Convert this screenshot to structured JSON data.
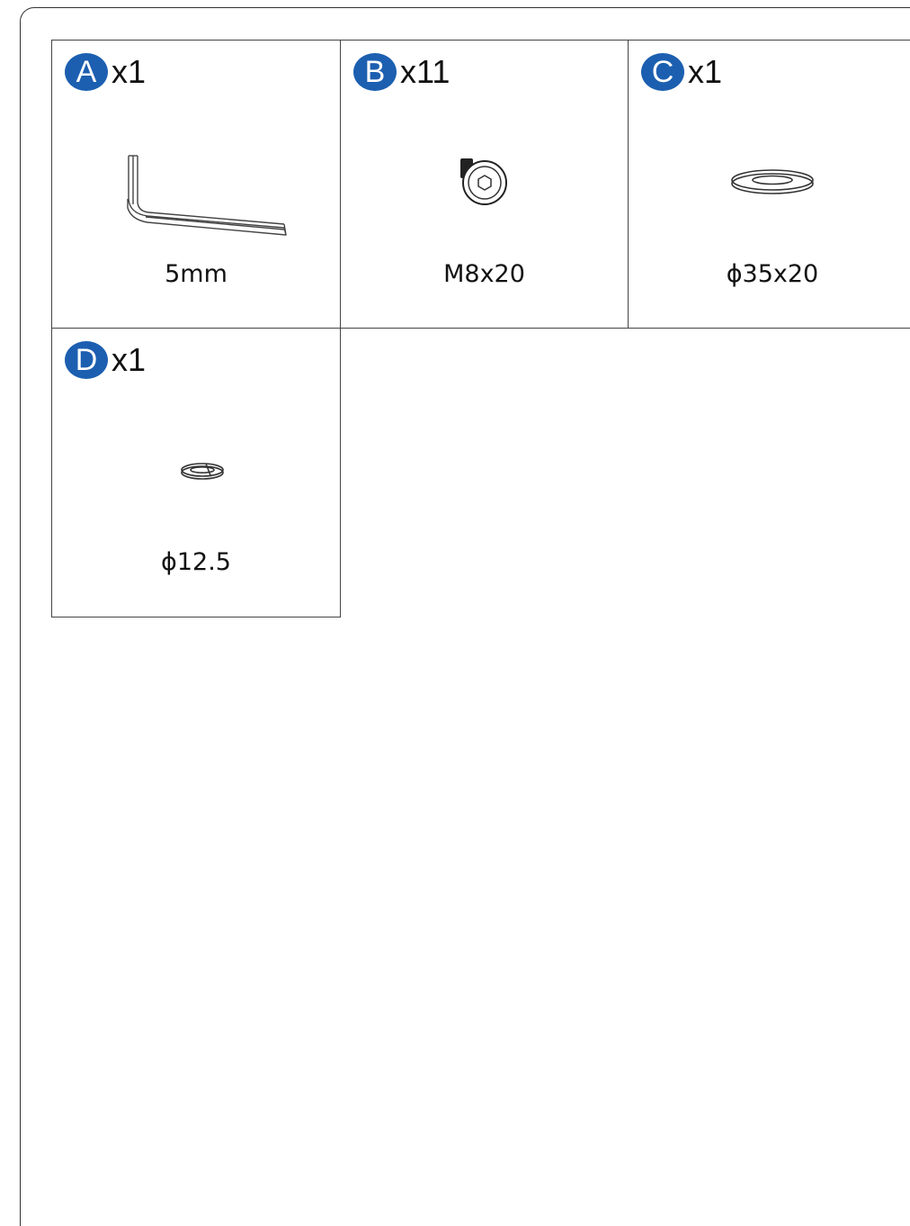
{
  "parts": [
    {
      "letter": "A",
      "qty": "x1",
      "spec": "5mm",
      "icon": "hex-key-icon"
    },
    {
      "letter": "B",
      "qty": "x11",
      "spec": "M8x20",
      "icon": "hex-bolt-icon"
    },
    {
      "letter": "C",
      "qty": "x1",
      "spec": "ϕ35x20",
      "icon": "flat-washer-icon"
    },
    {
      "letter": "D",
      "qty": "x1",
      "spec": "ϕ12.5",
      "icon": "spring-washer-icon"
    }
  ],
  "colors": {
    "badge": "#1c5fb0",
    "line": "#444444"
  }
}
